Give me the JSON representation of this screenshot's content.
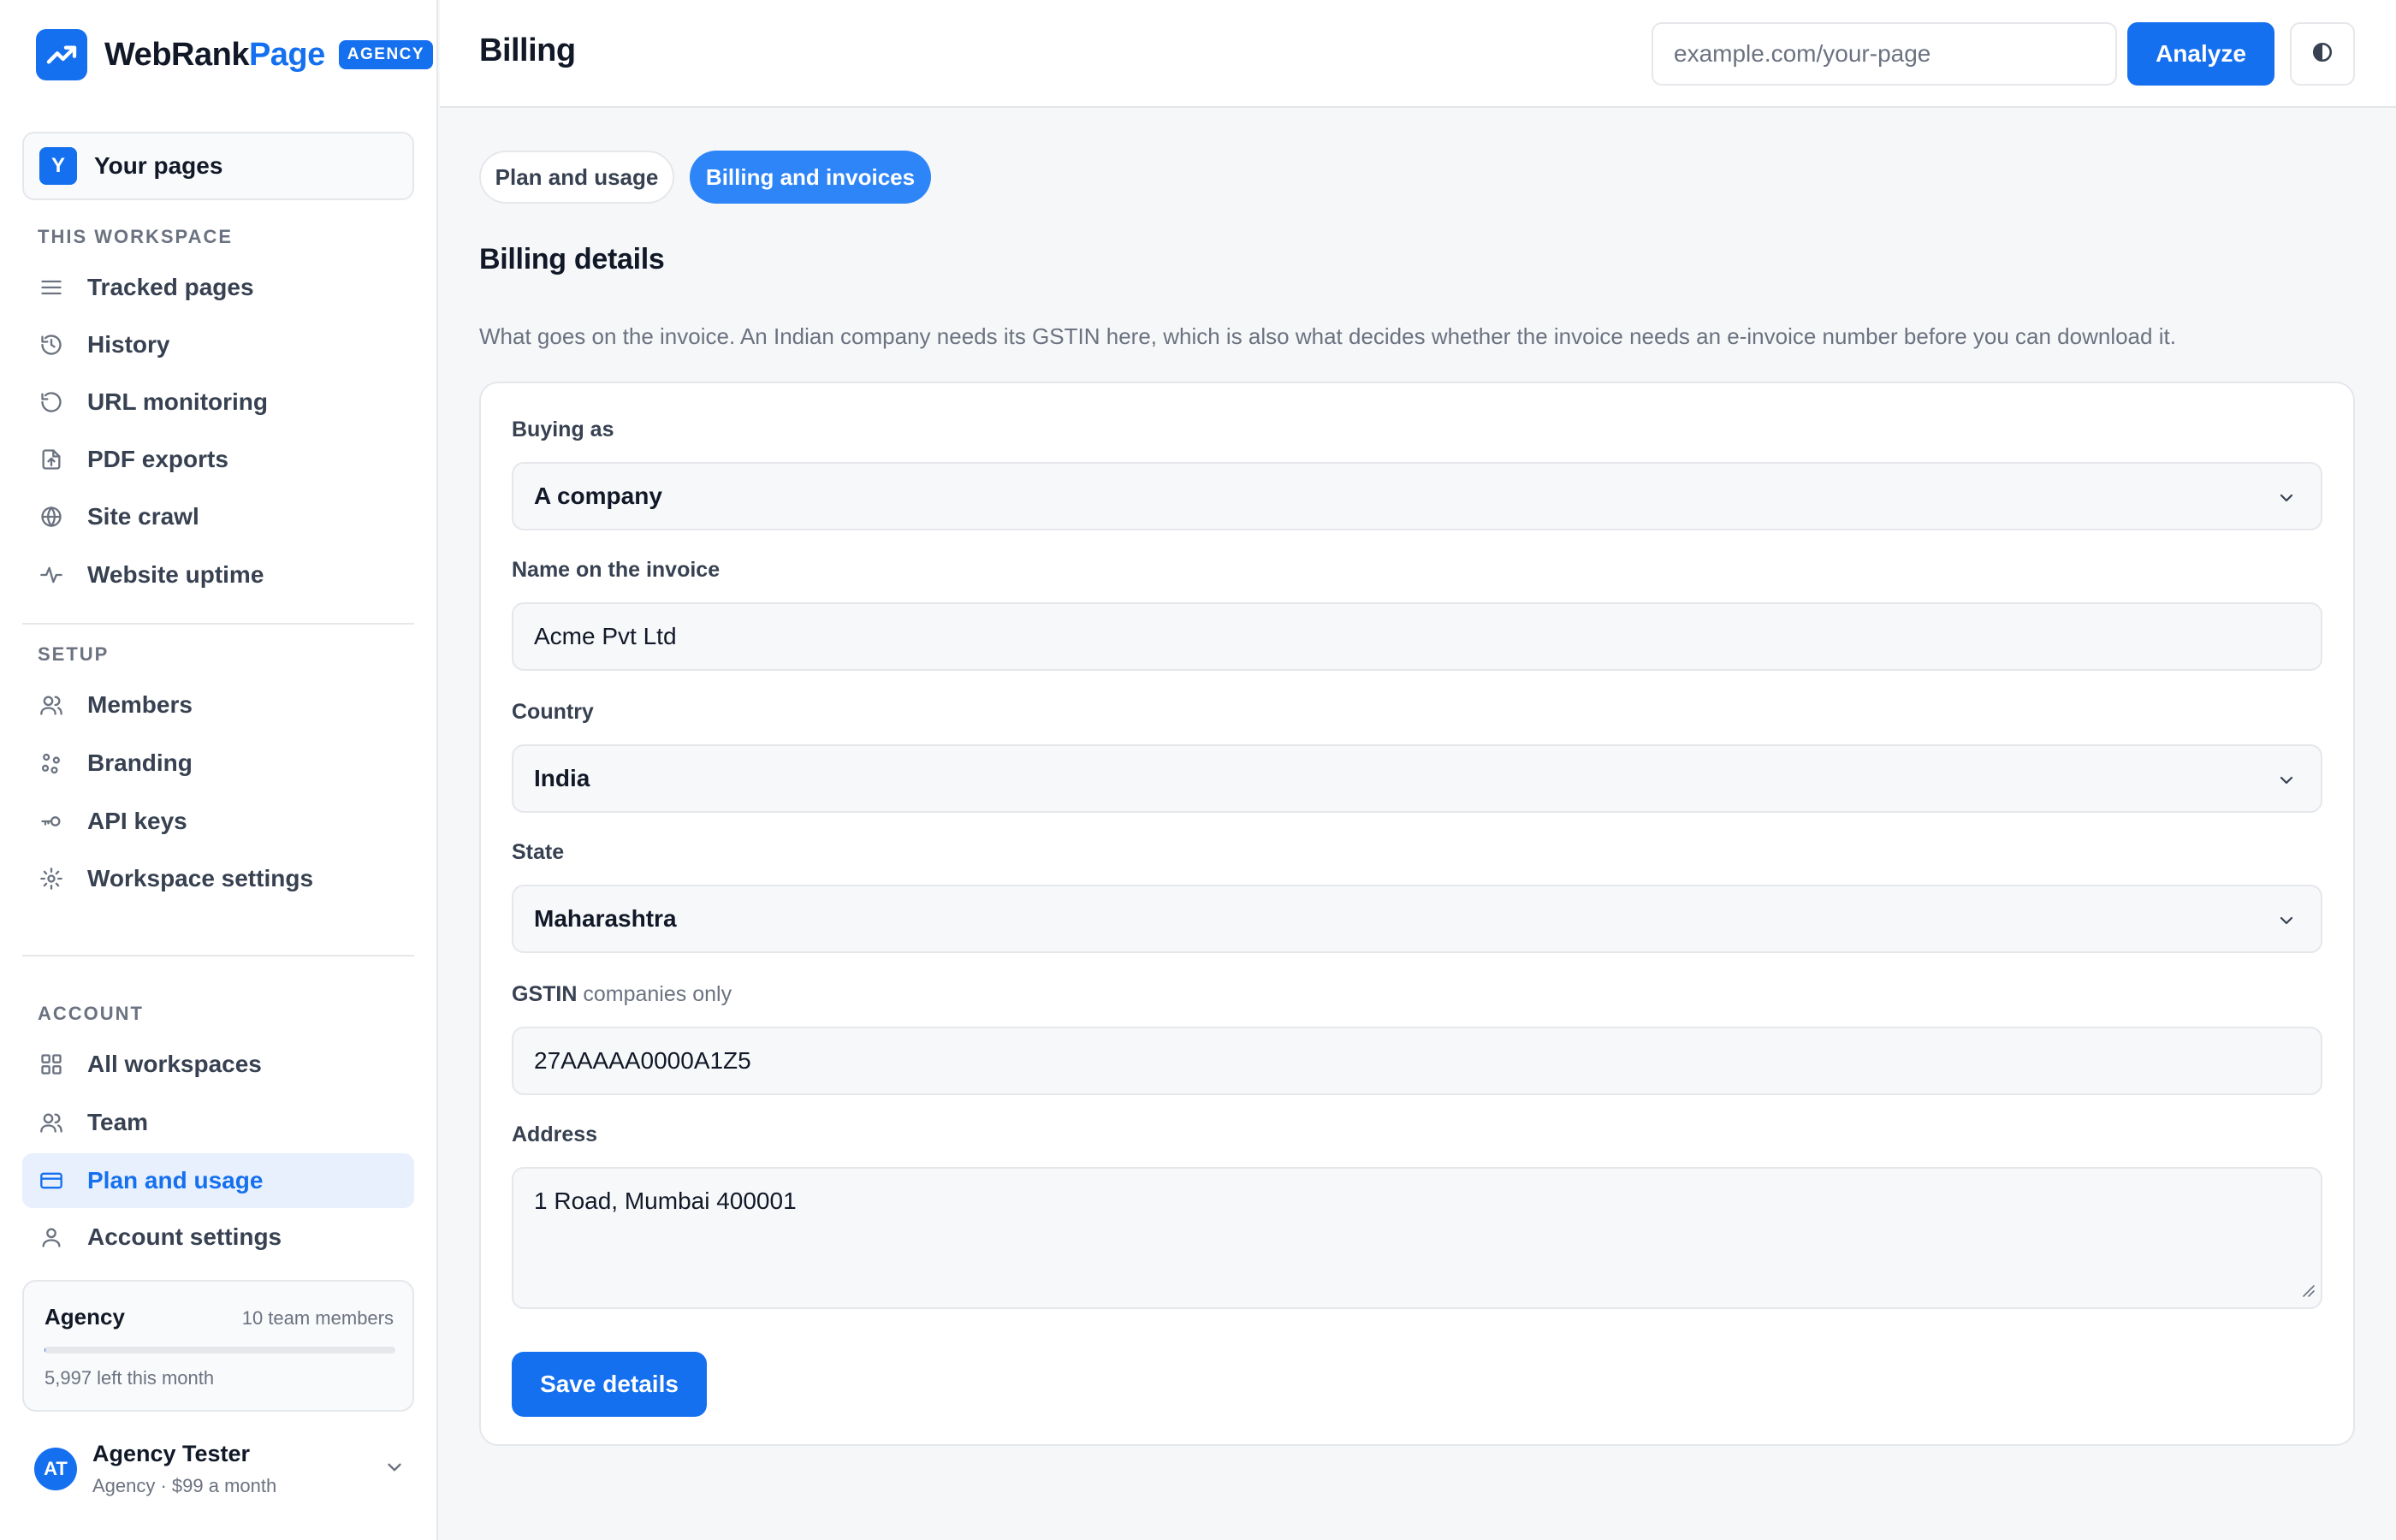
{
  "brand": {
    "name_part1": "WebRank",
    "name_part2": "Page",
    "badge": "AGENCY"
  },
  "workspace_switcher": {
    "initial": "Y",
    "label": "Your pages"
  },
  "sidebar": {
    "sections": {
      "workspace": "THIS WORKSPACE",
      "setup": "SETUP",
      "account": "ACCOUNT"
    },
    "workspace_items": [
      {
        "label": "Tracked pages",
        "icon": "list-icon"
      },
      {
        "label": "History",
        "icon": "history-icon"
      },
      {
        "label": "URL monitoring",
        "icon": "refresh-icon"
      },
      {
        "label": "PDF exports",
        "icon": "file-export-icon"
      },
      {
        "label": "Site crawl",
        "icon": "globe-icon"
      },
      {
        "label": "Website uptime",
        "icon": "pulse-icon"
      }
    ],
    "setup_items": [
      {
        "label": "Members",
        "icon": "users-icon"
      },
      {
        "label": "Branding",
        "icon": "palette-icon"
      },
      {
        "label": "API keys",
        "icon": "key-icon"
      },
      {
        "label": "Workspace settings",
        "icon": "gear-icon"
      }
    ],
    "account_items": [
      {
        "label": "All workspaces",
        "icon": "grid-icon"
      },
      {
        "label": "Team",
        "icon": "team-icon"
      },
      {
        "label": "Plan and usage",
        "icon": "credit-card-icon",
        "active": true
      },
      {
        "label": "Account settings",
        "icon": "user-icon"
      }
    ]
  },
  "plan": {
    "name": "Agency",
    "members": "10 team members",
    "usage_fraction": 0.0005,
    "remaining": "5,997 left this month"
  },
  "user": {
    "initials": "AT",
    "name": "Agency Tester",
    "plan": "Agency · $99 a month"
  },
  "header": {
    "title": "Billing",
    "url_placeholder": "example.com/your-page",
    "analyze_label": "Analyze"
  },
  "tabs": [
    {
      "label": "Plan and usage",
      "active": false
    },
    {
      "label": "Billing and invoices",
      "active": true
    }
  ],
  "billing": {
    "title": "Billing details",
    "description": "What goes on the invoice. An Indian company needs its GSTIN here, which is also what decides whether the invoice needs an e-invoice number before you can download it.",
    "fields": {
      "buying_as": {
        "label": "Buying as",
        "value": "A company"
      },
      "invoice_name": {
        "label": "Name on the invoice",
        "value": "Acme Pvt Ltd"
      },
      "country": {
        "label": "Country",
        "value": "India"
      },
      "state": {
        "label": "State",
        "value": "Maharashtra"
      },
      "gstin": {
        "label": "GSTIN",
        "hint": "companies only",
        "value": "27AAAAA0000A1Z5"
      },
      "address": {
        "label": "Address",
        "value": "1 Road, Mumbai 400001"
      }
    },
    "save_label": "Save details"
  },
  "colors": {
    "accent": "#1570ef",
    "active_tab": "#2e85f7",
    "active_nav_bg": "#e8f0fd"
  }
}
